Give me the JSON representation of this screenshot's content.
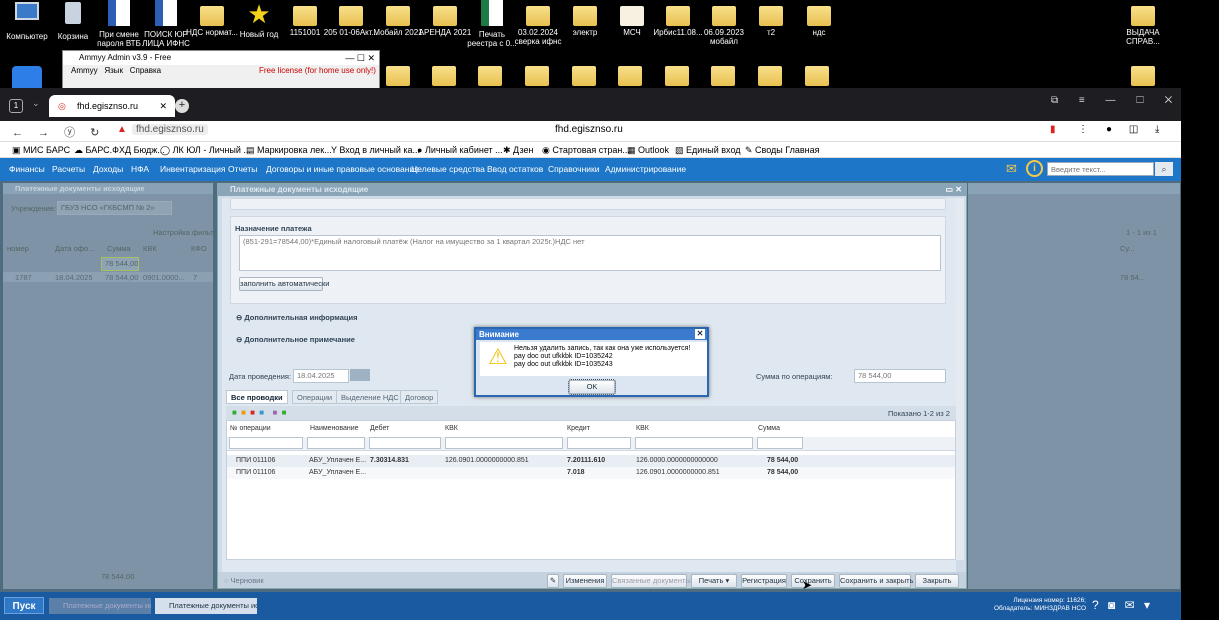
{
  "desktop": {
    "icons_top": [
      {
        "label": "Компьютер"
      },
      {
        "label": "Корзина"
      },
      {
        "label": "При смене пароля ВТБ"
      },
      {
        "label": "ПОИСК ЮР ЛИЦА ИФНС"
      },
      {
        "label": "НДС нормат..."
      },
      {
        "label": "Новый год"
      },
      {
        "label": "1151001"
      },
      {
        "label": "205 01-06Акт..."
      },
      {
        "label": "Мобайл 2021"
      },
      {
        "label": "АРЕНДА 2021"
      },
      {
        "label": "Печать реестра с 0..."
      },
      {
        "label": "03.02.2024 сверка ифнс"
      },
      {
        "label": "электр"
      },
      {
        "label": "МСЧ"
      },
      {
        "label": "Ирбис11.08..."
      },
      {
        "label": "06.09.2023 мобайл"
      },
      {
        "label": "т2"
      },
      {
        "label": "ндс"
      },
      {
        "label": "ВЫДАЧА СПРАВ..."
      }
    ]
  },
  "ammyy": {
    "title": "Ammyy Admin v3.9 - Free",
    "menu": [
      "Ammyy",
      "Язык",
      "Справка"
    ],
    "license": "Free license (for home use only!)"
  },
  "browser": {
    "tab_title": "fhd.egisznso.ru",
    "address_chip": "fhd.egisznso.ru",
    "address_center": "fhd.egisznso.ru",
    "bookmarks": [
      "МИС БАРС",
      "БАРС.ФХД Бюдж...",
      "ЛК ЮЛ - Личный ...",
      "Маркировка лек...",
      "Вход в личный ка...",
      "Личный кабинет ...",
      "Дзен",
      "Стартовая стран...",
      "Outlook",
      "Единый вход",
      "Своды Главная"
    ]
  },
  "app": {
    "nav": [
      "Финансы",
      "Расчеты",
      "Доходы",
      "НФА",
      "Инвентаризация",
      "Отчеты",
      "Договоры и иные правовые основания",
      "Целевые средства",
      "Ввод остатков",
      "Справочники",
      "Администрирование"
    ],
    "search_placeholder": "Введите текст...",
    "left_panel": {
      "title": "Платежные документы исходящие",
      "institution_label": "Учреждение:",
      "institution_value": "ГБУЗ НСО «ГКБСМП № 2»",
      "filter_label": "Настройка фильтр...",
      "cols": [
        "номер",
        "Дата офо...",
        "Сумма",
        "КВК",
        "КФО"
      ],
      "filter_sum": "78 544,00",
      "row": {
        "num": "1787",
        "date": "18.04.2025",
        "sum": "78 544,00",
        "kvk": "0901.0000...",
        "kfo": "7"
      },
      "footer_sum": "78 544,00"
    },
    "right_panel": {
      "pager": "1 - 1 из 1",
      "col": "Су...",
      "row_sum": "78 54..."
    },
    "main": {
      "title": "Платежные документы исходящие",
      "purpose_label": "Назначение платежа",
      "purpose_text": "(851-291=78544,00)*Единый налоговый платёж (Налог на имущество за 1 квартал 2025г.)НДС нет",
      "fill_auto": "заполнить автоматически",
      "extra_info": "Дополнительная информация",
      "extra_note": "Дополнительное примечание",
      "date_label": "Дата проведения:",
      "date_value": "18.04.2025",
      "sum_label": "Сумма по операциям:",
      "sum_value": "78 544,00",
      "tabs": [
        "Все проводки",
        "Операции",
        "Выделение НДС",
        "Договор"
      ],
      "shown": "Показано 1-2 из 2",
      "grid_cols": [
        "№ операции",
        "Наименование",
        "Дебет",
        "КВК",
        "Кредит",
        "КВК",
        "Сумма"
      ],
      "grid_rows": [
        {
          "op": "ППИ 011106",
          "name": "АБУ_Уплачен Е...",
          "debit": "7.30314.831",
          "kvk1": "126.0901.0000000000.851",
          "credit": "7.20111.610",
          "kvk2": "126.0000.0000000000000",
          "sum": "78 544,00"
        },
        {
          "op": "ППИ 011106",
          "name": "АБУ_Уплачен Е...",
          "debit": "",
          "kvk1": "",
          "credit": "7.018",
          "kvk2": "126.0901.0000000000.851",
          "sum": "78 544,00"
        }
      ],
      "draft": "Черновик",
      "buttons": [
        "Изменения",
        "Связанные документы",
        "Печать",
        "Регистрация",
        "Сохранить",
        "Сохранить и закрыть",
        "Закрыть"
      ]
    },
    "dialog": {
      "title": "Внимание",
      "lines": [
        "Нельзя удалить запись, так как она уже используется!",
        "pay doc out ufkkbk ID=1035242",
        "pay doc out ufkkbk ID=1035243"
      ],
      "ok": "OK"
    },
    "taskbar": {
      "start": "Пуск",
      "items": [
        "Платежные документы ис...",
        "Платежные документы ис..."
      ],
      "license": "Лицензия номер: 11626; Обладатель: МИНЗДРАВ НСО"
    }
  }
}
